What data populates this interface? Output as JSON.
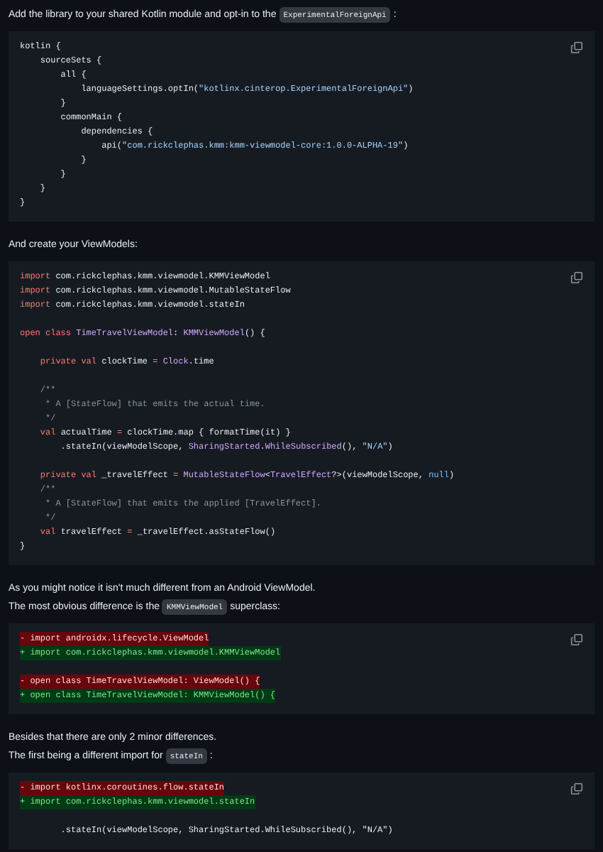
{
  "blocks": [
    {
      "kind": "paragraph",
      "lines": [
        {
          "parts": [
            {
              "kind": "text",
              "text": "Add the library to your shared Kotlin module and opt-in to the"
            },
            {
              "kind": "code",
              "text": "ExperimentalForeignApi"
            },
            {
              "kind": "text",
              "text": ":"
            }
          ]
        }
      ]
    },
    {
      "kind": "code",
      "lines": [
        {
          "kind": "code",
          "tokens": [
            {
              "kind": "plain",
              "text": "kotlin {"
            }
          ]
        },
        {
          "kind": "code",
          "tokens": [
            {
              "kind": "plain",
              "text": "    sourceSets {"
            }
          ]
        },
        {
          "kind": "code",
          "tokens": [
            {
              "kind": "plain",
              "text": "        all {"
            }
          ]
        },
        {
          "kind": "code",
          "tokens": [
            {
              "kind": "plain",
              "text": "            languageSettings.optIn("
            },
            {
              "kind": "string",
              "text": "\"kotlinx.cinterop.ExperimentalForeignApi\""
            },
            {
              "kind": "plain",
              "text": ")"
            }
          ]
        },
        {
          "kind": "code",
          "tokens": [
            {
              "kind": "plain",
              "text": "        }"
            }
          ]
        },
        {
          "kind": "code",
          "tokens": [
            {
              "kind": "plain",
              "text": "        commonMain {"
            }
          ]
        },
        {
          "kind": "code",
          "tokens": [
            {
              "kind": "plain",
              "text": "            dependencies {"
            }
          ]
        },
        {
          "kind": "code",
          "tokens": [
            {
              "kind": "plain",
              "text": "                api("
            },
            {
              "kind": "string",
              "text": "\"com.rickclephas.kmm:kmm-viewmodel-core:1.0.0-ALPHA-19\""
            },
            {
              "kind": "plain",
              "text": ")"
            }
          ]
        },
        {
          "kind": "code",
          "tokens": [
            {
              "kind": "plain",
              "text": "            }"
            }
          ]
        },
        {
          "kind": "code",
          "tokens": [
            {
              "kind": "plain",
              "text": "        }"
            }
          ]
        },
        {
          "kind": "code",
          "tokens": [
            {
              "kind": "plain",
              "text": "    }"
            }
          ]
        },
        {
          "kind": "code",
          "tokens": [
            {
              "kind": "plain",
              "text": "}"
            }
          ]
        }
      ]
    },
    {
      "kind": "paragraph",
      "lines": [
        {
          "parts": [
            {
              "kind": "text",
              "text": "And create your ViewModels:"
            }
          ]
        }
      ]
    },
    {
      "kind": "code",
      "lines": [
        {
          "kind": "code",
          "tokens": [
            {
              "kind": "keyword",
              "text": "import"
            },
            {
              "kind": "plain",
              "text": " com.rickclephas.kmm.viewmodel.KMMViewModel"
            }
          ]
        },
        {
          "kind": "code",
          "tokens": [
            {
              "kind": "keyword",
              "text": "import"
            },
            {
              "kind": "plain",
              "text": " com.rickclephas.kmm.viewmodel.MutableStateFlow"
            }
          ]
        },
        {
          "kind": "code",
          "tokens": [
            {
              "kind": "keyword",
              "text": "import"
            },
            {
              "kind": "plain",
              "text": " com.rickclephas.kmm.viewmodel.stateIn"
            }
          ]
        },
        {
          "kind": "blank"
        },
        {
          "kind": "code",
          "tokens": [
            {
              "kind": "keyword",
              "text": "open class "
            },
            {
              "kind": "type",
              "text": "TimeTravelViewModel"
            },
            {
              "kind": "plain",
              "text": ": "
            },
            {
              "kind": "type",
              "text": "KMMViewModel"
            },
            {
              "kind": "plain",
              "text": "() {"
            }
          ]
        },
        {
          "kind": "blank"
        },
        {
          "kind": "code",
          "tokens": [
            {
              "kind": "keyword",
              "text": "    private val"
            },
            {
              "kind": "plain",
              "text": " clockTime "
            },
            {
              "kind": "keyword",
              "text": "= "
            },
            {
              "kind": "type",
              "text": "Clock"
            },
            {
              "kind": "plain",
              "text": ".time"
            }
          ]
        },
        {
          "kind": "blank"
        },
        {
          "kind": "code",
          "tokens": [
            {
              "kind": "comment",
              "text": "    /**"
            }
          ]
        },
        {
          "kind": "code",
          "tokens": [
            {
              "kind": "comment",
              "text": "     * A [StateFlow] that emits the actual time."
            }
          ]
        },
        {
          "kind": "code",
          "tokens": [
            {
              "kind": "comment",
              "text": "     */"
            }
          ]
        },
        {
          "kind": "code",
          "tokens": [
            {
              "kind": "keyword",
              "text": "    val"
            },
            {
              "kind": "plain",
              "text": " actualTime "
            },
            {
              "kind": "keyword",
              "text": "="
            },
            {
              "kind": "plain",
              "text": " clockTime.map { formatTime(it) }"
            }
          ]
        },
        {
          "kind": "code",
          "tokens": [
            {
              "kind": "plain",
              "text": "        .stateIn(viewModelScope, "
            },
            {
              "kind": "type",
              "text": "SharingStarted"
            },
            {
              "kind": "plain",
              "text": "."
            },
            {
              "kind": "type",
              "text": "WhileSubscribed"
            },
            {
              "kind": "plain",
              "text": "(), "
            },
            {
              "kind": "string",
              "text": "\"N/A\""
            },
            {
              "kind": "plain",
              "text": ")"
            }
          ]
        },
        {
          "kind": "blank"
        },
        {
          "kind": "code",
          "tokens": [
            {
              "kind": "keyword",
              "text": "    private val"
            },
            {
              "kind": "plain",
              "text": " _travelEffect "
            },
            {
              "kind": "keyword",
              "text": "= "
            },
            {
              "kind": "type",
              "text": "MutableStateFlow"
            },
            {
              "kind": "plain",
              "text": "<"
            },
            {
              "kind": "type",
              "text": "TravelEffect"
            },
            {
              "kind": "plain",
              "text": "?>(viewModelScope, "
            },
            {
              "kind": "constant",
              "text": "null"
            },
            {
              "kind": "plain",
              "text": ")"
            }
          ]
        },
        {
          "kind": "code",
          "tokens": [
            {
              "kind": "comment",
              "text": "    /**"
            }
          ]
        },
        {
          "kind": "code",
          "tokens": [
            {
              "kind": "comment",
              "text": "     * A [StateFlow] that emits the applied [TravelEffect]."
            }
          ]
        },
        {
          "kind": "code",
          "tokens": [
            {
              "kind": "comment",
              "text": "     */"
            }
          ]
        },
        {
          "kind": "code",
          "tokens": [
            {
              "kind": "keyword",
              "text": "    val"
            },
            {
              "kind": "plain",
              "text": " travelEffect "
            },
            {
              "kind": "keyword",
              "text": "="
            },
            {
              "kind": "plain",
              "text": " _travelEffect.asStateFlow()"
            }
          ]
        },
        {
          "kind": "code",
          "tokens": [
            {
              "kind": "plain",
              "text": "}"
            }
          ]
        }
      ]
    },
    {
      "kind": "paragraph",
      "lines": [
        {
          "parts": [
            {
              "kind": "text",
              "text": "As you might notice it isn't much different from an Android ViewModel."
            }
          ]
        },
        {
          "parts": [
            {
              "kind": "text",
              "text": "The most obvious difference is the"
            },
            {
              "kind": "code",
              "text": "KMMViewModel"
            },
            {
              "kind": "text",
              "text": "superclass:"
            }
          ]
        }
      ]
    },
    {
      "kind": "code",
      "lines": [
        {
          "kind": "removed",
          "text": "- import androidx.lifecycle.ViewModel"
        },
        {
          "kind": "added",
          "text": "+ import com.rickclephas.kmm.viewmodel.KMMViewModel"
        },
        {
          "kind": "blank"
        },
        {
          "kind": "removed",
          "text": "- open class TimeTravelViewModel: ViewModel() {"
        },
        {
          "kind": "added",
          "text": "+ open class TimeTravelViewModel: KMMViewModel() {"
        }
      ]
    },
    {
      "kind": "paragraph",
      "lines": [
        {
          "parts": [
            {
              "kind": "text",
              "text": "Besides that there are only 2 minor differences."
            }
          ]
        },
        {
          "parts": [
            {
              "kind": "text",
              "text": "The first being a different import for"
            },
            {
              "kind": "code",
              "text": "stateIn"
            },
            {
              "kind": "text",
              "text": ":"
            }
          ]
        }
      ]
    },
    {
      "kind": "code",
      "lines": [
        {
          "kind": "removed",
          "text": "- import kotlinx.coroutines.flow.stateIn"
        },
        {
          "kind": "added",
          "text": "+ import com.rickclephas.kmm.viewmodel.stateIn"
        },
        {
          "kind": "blank"
        },
        {
          "kind": "code",
          "tokens": [
            {
              "kind": "plain",
              "text": "        .stateIn(viewModelScope, SharingStarted.WhileSubscribed(), \"N/A\")"
            }
          ]
        }
      ]
    }
  ]
}
